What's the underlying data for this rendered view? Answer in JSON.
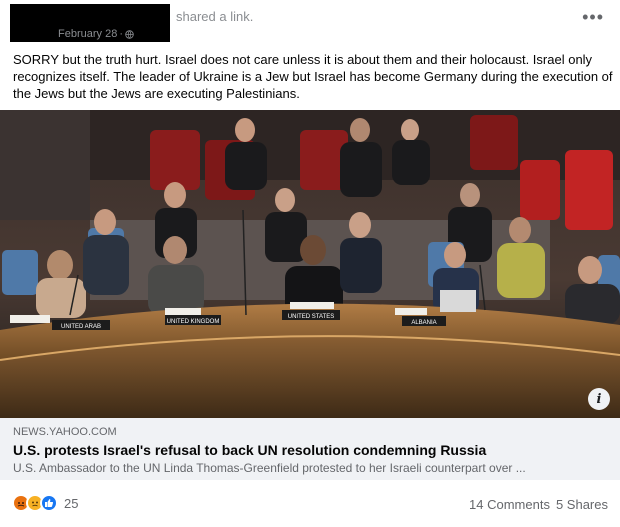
{
  "header": {
    "shared_text": "shared a link.",
    "date": "February 28",
    "date_separator": "·",
    "more_label": "•••"
  },
  "post": {
    "text": "SORRY but the truth hurt. Israel does not care unless it is about them and their holocaust. Israel only recognizes itself. The leader of Ukraine is a Jew but Israel has become Germany during the execution of the Jews but the Jews are executing Palestinians."
  },
  "photo": {
    "nameplates": [
      "UNITED ARAB",
      "UNITED KINGDOM",
      "UNITED STATES",
      "ALBANIA"
    ],
    "info_label": "i"
  },
  "link": {
    "domain": "NEWS.YAHOO.COM",
    "headline": "U.S. protests Israel's refusal to back UN resolution condemning Russia",
    "description": "U.S. Ambassador to the UN Linda Thomas-Greenfield protested to her Israeli counterpart over ..."
  },
  "footer": {
    "reaction_icons": [
      "angry-icon",
      "sad-icon",
      "like-icon"
    ],
    "reaction_count": "25",
    "comments": "14 Comments",
    "shares": "5 Shares"
  },
  "colors": {
    "meta_gray": "#65676b",
    "link_bg": "#f0f2f5",
    "like_blue": "#1877f2",
    "angry_orange": "#e9710f",
    "sad_yellow": "#f7b125"
  }
}
